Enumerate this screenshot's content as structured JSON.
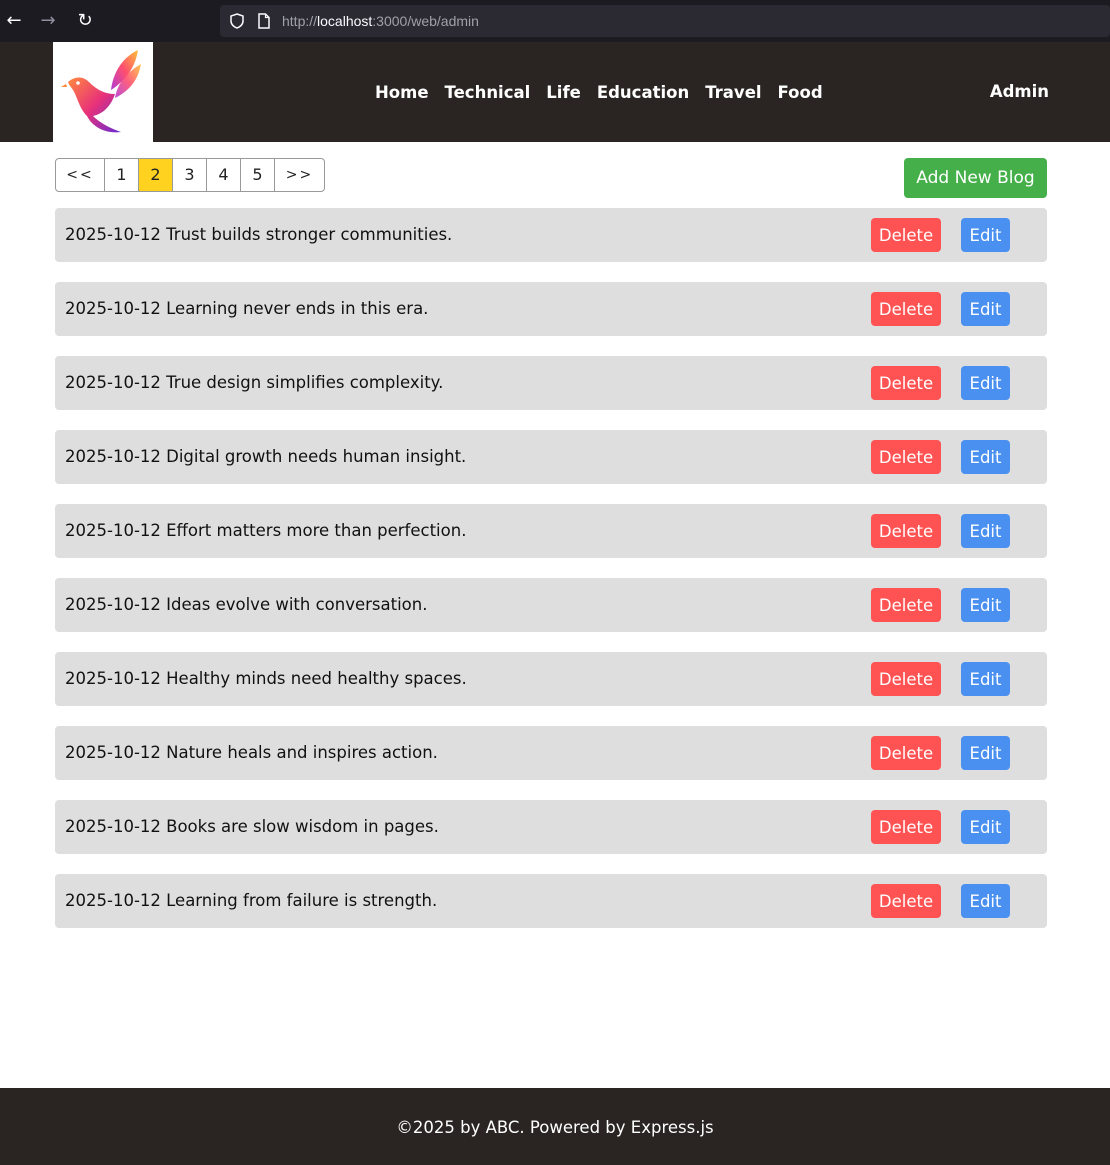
{
  "browser": {
    "url_prefix": "http://",
    "url_host": "localhost",
    "url_rest": ":3000/web/admin",
    "back_icon": "arrow-left",
    "forward_icon": "arrow-right",
    "reload_icon": "reload",
    "back_glyph": "←",
    "forward_glyph": "→",
    "reload_glyph": "↻"
  },
  "header": {
    "logo": "bird-logo",
    "nav": [
      "Home",
      "Technical",
      "Life",
      "Education",
      "Travel",
      "Food"
    ],
    "admin_label": "Admin"
  },
  "pagination": {
    "prev_label": "<<",
    "next_label": ">>",
    "pages": [
      "1",
      "2",
      "3",
      "4",
      "5"
    ],
    "active_page": "2",
    "active_color": "#ffd21f"
  },
  "add_button_label": "Add New Blog",
  "actions": {
    "delete_label": "Delete",
    "edit_label": "Edit"
  },
  "blogs": [
    "2025-10-12 Trust builds stronger communities.",
    "2025-10-12 Learning never ends in this era.",
    "2025-10-12 True design simplifies complexity.",
    "2025-10-12 Digital growth needs human insight.",
    "2025-10-12 Effort matters more than perfection.",
    "2025-10-12 Ideas evolve with conversation.",
    "2025-10-12 Healthy minds need healthy spaces.",
    "2025-10-12 Nature heals and inspires action.",
    "2025-10-12 Books are slow wisdom in pages.",
    "2025-10-12 Learning from failure is strength."
  ],
  "footer": {
    "text": "©2025 by ABC. Powered by Express.js"
  },
  "colors": {
    "header_bg": "#2a2523",
    "add_button": "#45b04a",
    "delete_button": "#ff5252",
    "edit_button": "#4a90f0",
    "row_bg": "#dedede"
  }
}
